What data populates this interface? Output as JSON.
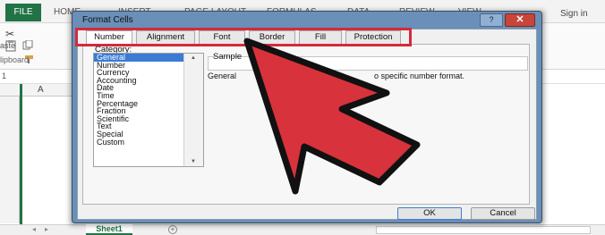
{
  "excel": {
    "file_tab": "FILE",
    "ribbon_tabs": [
      "HOME",
      "INSERT",
      "PAGE LAYOUT",
      "FORMULAS",
      "DATA",
      "REVIEW",
      "VIEW"
    ],
    "sign_in": "Sign in",
    "paste_label": "aste",
    "clipboard_label": "lipboard",
    "name_box": "1",
    "column_a": "A",
    "sheet_tab": "Sheet1",
    "add_sheet": "+",
    "accent": "#217346"
  },
  "dialog": {
    "title": "Format Cells",
    "help": "?",
    "close": "✕",
    "tabs": [
      "Number",
      "Alignment",
      "Font",
      "Border",
      "Fill",
      "Protection"
    ],
    "active_tab": "Number",
    "category_label": "Category:",
    "categories": [
      "General",
      "Number",
      "Currency",
      "Accounting",
      "Date",
      "Time",
      "Percentage",
      "Fraction",
      "Scientific",
      "Text",
      "Special",
      "Custom"
    ],
    "selected_category": "General",
    "sample_label": "Sample",
    "general_desc": "General",
    "desc_tail": "o specific number format.",
    "ok": "OK",
    "cancel": "Cancel",
    "highlight_color": "#d42a3b"
  },
  "overlay": {
    "arrow_color": "#d8323c",
    "arrow_icon": "pointer-arrow-icon"
  }
}
